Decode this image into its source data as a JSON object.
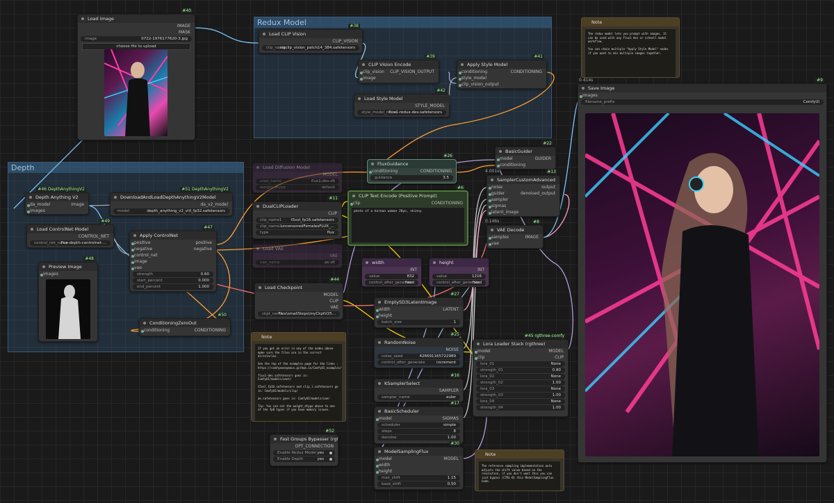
{
  "groups": {
    "redux": "Redux Model",
    "depth": "Depth"
  },
  "nodes": {
    "load_image": {
      "id": "#40",
      "title": "Load Image",
      "out1": "IMAGE",
      "out2": "MASK",
      "w_image_label": "image",
      "w_image_val": "0722-1976177620-3.jpg",
      "upload": "choose file to upload"
    },
    "load_clip_vision": {
      "id": "#38",
      "title": "Load CLIP Vision",
      "out": "CLIP_VISION",
      "w_label": "clip_name",
      "w_val": "sigclip_vision_patch14_384.safetensors"
    },
    "clip_vision_encode": {
      "id": "#39",
      "title": "CLIP Vision Encode",
      "in1": "clip_vision",
      "in2": "image",
      "out": "CLIP_VISION_OUTPUT"
    },
    "apply_style_model": {
      "id": "#41",
      "title": "Apply Style Model",
      "in1": "conditioning",
      "in2": "style_model",
      "in3": "clip_vision_output",
      "out": "CONDITIONING"
    },
    "load_style_model": {
      "id": "#42",
      "title": "Load Style Model",
      "out": "STYLE_MODEL",
      "w_label": "style_model_name",
      "w_val": "flux1-redux-dev.safetensors"
    },
    "note_top": {
      "title": "Note",
      "text": "The redux model lets you prompt with images. It can be used with any Flux1 dev or schnell model workflow.\n\nYou can chain multiple \"Apply Style Model\" nodes if you want to mix multiple images together."
    },
    "save_image": {
      "id": "#9",
      "title": "Save Image",
      "badge": "0.414s",
      "in": "images",
      "w_label": "filename_prefix",
      "w_val": "ComfyUI"
    },
    "depth_anything": {
      "id": "#46 DepthAnythingV2",
      "title": "Depth Anything V2",
      "in1": "da_model",
      "in2": "images",
      "out": "image"
    },
    "download_depth": {
      "id": "#51 DepthAnythingV2",
      "title": "DownloadAndLoadDepthAnythingV2Model",
      "out": "da_v2_model",
      "w_label": "model",
      "w_val": "depth_anything_v2_vitl_fp32.safetensors"
    },
    "load_controlnet": {
      "id": "#49",
      "title": "Load ControlNet Model",
      "out": "CONTROL_NET",
      "w_label": "control_net_name",
      "w_val": "flux-depth-controlnet-..."
    },
    "apply_controlnet": {
      "id": "#47",
      "title": "Apply ControlNet",
      "in1": "positive",
      "in2": "negative",
      "in3": "control_net",
      "in4": "image",
      "in5": "vae",
      "out1": "positive",
      "out2": "negative",
      "strength": "strength",
      "strength_v": "0.60",
      "start": "start_percent",
      "start_v": "0.000",
      "end": "end_percent",
      "end_v": "1.000"
    },
    "preview_image": {
      "id": "#48",
      "title": "Preview Image",
      "in": "images"
    },
    "conditioning_zero": {
      "id": "#50",
      "title": "ConditioningZeroOut",
      "in": "conditioning",
      "out": "CONDITIONING"
    },
    "load_diffusion": {
      "title": "Load Diffusion Model",
      "out": "MODEL",
      "w1": "unet_name",
      "w1v": "flux1-dev.sft",
      "w2": "weight_dtype",
      "w2v": "default"
    },
    "dual_clip": {
      "id": "#11",
      "title": "DualCLIPLoader",
      "out": "CLIP",
      "w1": "clip_name1",
      "w1v": "t5xxl_fp16.safetensors",
      "w2": "clip_name2",
      "w2v": "uncensoredFemalesFLUX_...",
      "w3": "type",
      "w3v": "flux"
    },
    "load_vae": {
      "title": "Load VAE",
      "out": "VAE",
      "w": "vae_name",
      "wv": "ae.sft"
    },
    "load_checkpoint": {
      "id": "#44",
      "title": "Load Checkpoint",
      "out1": "MODEL",
      "out2": "CLIP",
      "out3": "VAE",
      "w": "ckpt_name",
      "wv": "Flux\\smallSteps\\myCkptV25..."
    },
    "flux_guidance": {
      "id": "#26",
      "title": "FluxGuidance",
      "in": "conditioning",
      "out": "CONDITIONING",
      "w": "guidance",
      "wv": "3.5"
    },
    "clip_text_encode": {
      "id": "#6",
      "title": "CLIP Text Encode (Positive Prompt)",
      "in": "clip",
      "out": "CONDITIONING",
      "text": "photo of a korean woman 28yo, skinny"
    },
    "basic_guider": {
      "id": "#22",
      "title": "BasicGuider",
      "in1": "model",
      "in2": "conditioning",
      "out": "GUIDER",
      "badge": "4.001s"
    },
    "sampler_custom": {
      "id": "#13",
      "title": "SamplerCustomAdvanced",
      "in1": "noise",
      "in2": "guider",
      "in3": "sampler",
      "in4": "sigmas",
      "in5": "latent_image",
      "out1": "output",
      "out2": "denoised_output"
    },
    "vae_decode": {
      "id": "#8",
      "title": "VAE Decode",
      "badge": "0.146s",
      "in1": "samples",
      "in2": "vae",
      "out": "IMAGE"
    },
    "width": {
      "title": "width",
      "out": "INT",
      "w": "value",
      "wv": "832",
      "w2": "control_after_generate",
      "w2v": "fixed"
    },
    "height": {
      "title": "height",
      "out": "INT",
      "w": "value",
      "wv": "1216",
      "w2": "control_after_generate",
      "w2v": "fixed"
    },
    "empty_latent": {
      "id": "#27",
      "title": "EmptySD3LatentImage",
      "in1": "width",
      "in2": "height",
      "out": "LATENT",
      "w": "batch_size",
      "wv": "1"
    },
    "random_noise": {
      "id": "#25",
      "title": "RandomNoise",
      "out": "NOISE",
      "w1": "noise_seed",
      "w1v": "426691165722989",
      "w2": "control_after_generate",
      "w2v": "increment"
    },
    "ksampler_select": {
      "id": "#16",
      "title": "KSamplerSelect",
      "out": "SAMPLER",
      "w": "sampler_name",
      "wv": "euler"
    },
    "basic_scheduler": {
      "id": "#17",
      "title": "BasicScheduler",
      "in": "model",
      "out": "SIGMAS",
      "w1": "scheduler",
      "w1v": "simple",
      "w2": "steps",
      "w2v": "8",
      "w3": "denoise",
      "w3v": "1.00"
    },
    "model_sampling": {
      "id": "#30",
      "title": "ModelSamplingFlux",
      "in1": "model",
      "in2": "width",
      "in3": "height",
      "out": "MODEL",
      "w1": "max_shift",
      "w1v": "1.15",
      "w2": "base_shift",
      "w2v": "0.50"
    },
    "lora_stack": {
      "id": "#45 rgthree-comfy",
      "title": "Lora Loader Stack (rgthree)",
      "in1": "model",
      "in2": "clip",
      "out1": "MODEL",
      "out2": "CLIP",
      "rows": [
        [
          "lora_01",
          "None"
        ],
        [
          "strength_01",
          "0.80"
        ],
        [
          "lora_02",
          "None"
        ],
        [
          "strength_02",
          "1.00"
        ],
        [
          "lora_03",
          "None"
        ],
        [
          "strength_03",
          "1.00"
        ],
        [
          "lora_04",
          "None"
        ],
        [
          "strength_04",
          "1.00"
        ]
      ]
    },
    "fast_groups": {
      "id": "#52",
      "title": "Fast Groups Bypasser (rgthree)",
      "out": "OPT_CONNECTION",
      "r1": "Enable Redux Model",
      "r1v": "yes",
      "r2": "Enable Depth",
      "r2v": "yes"
    },
    "note_mid": {
      "title": "Note",
      "text": "If you get an error in any of the nodes above make sure the files are in the correct directories.\n\nSee the top of the examples page for the links : https://comfyanonymous.github.io/ComfyUI_examples/flux/\n\nflux1-dev.safetensors goes in: ComfyUI/models/unet/\n\nt5xxl_fp16.safetensors and clip_l.safetensors go in: ComfyUI/models/clip/\n\nae.safetensors goes in: ComfyUI/models/vae/\n\nTip: You can set the weight_dtype above to one of the fp8 types if you have memory issues."
    },
    "note_bottom": {
      "title": "Note",
      "text": "The reference sampling implementation auto adjusts the shift value based on the resolution, if you don't want this you can just bypass (CTRL-B) this ModelSamplingFlux node."
    }
  },
  "colors": {
    "accent": "#6ab04c",
    "group": "#3a668c",
    "note": "#4d3f23",
    "int_node": "#4a3350"
  }
}
